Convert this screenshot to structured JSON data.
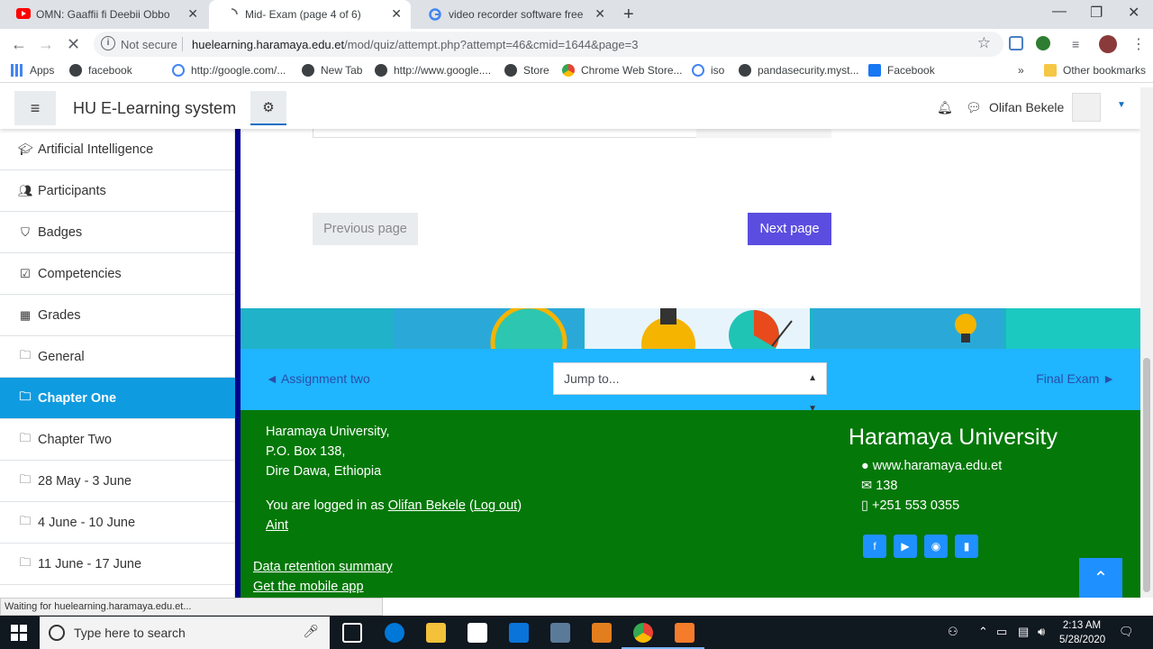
{
  "browser": {
    "tabs": [
      {
        "title": "OMN: Gaaffii fi Deebii Obbo Hay",
        "icon": "youtube-icon",
        "active": false
      },
      {
        "title": "Mid- Exam (page 4 of 6)",
        "icon": "loading-icon",
        "active": true
      },
      {
        "title": "video recorder software free dow",
        "icon": "google-icon",
        "active": false
      }
    ],
    "security": "Not secure",
    "url_host": "huelearning.haramaya.edu.et",
    "url_path": "/mod/quiz/attempt.php?attempt=46&cmid=1644&page=3",
    "bookmarks": [
      {
        "label": "Apps",
        "icon": "apps-grid-icon"
      },
      {
        "label": "facebook",
        "icon": "globe-icon"
      },
      {
        "label": "http://google.com/...",
        "icon": "google-icon"
      },
      {
        "label": "New Tab",
        "icon": "globe-icon"
      },
      {
        "label": "http://www.google....",
        "icon": "globe-icon"
      },
      {
        "label": "Store",
        "icon": "globe-icon"
      },
      {
        "label": "Chrome Web Store...",
        "icon": "chrome-store-icon"
      },
      {
        "label": "iso",
        "icon": "google-icon"
      },
      {
        "label": "pandasecurity.myst...",
        "icon": "globe-icon"
      },
      {
        "label": "Facebook",
        "icon": "facebook-icon"
      }
    ],
    "more_bookmarks": "»",
    "other_bookmarks": "Other bookmarks",
    "status_text": "Waiting for huelearning.haramaya.edu.et..."
  },
  "site": {
    "name": "HU E-Learning system",
    "user_name": "Olifan Bekele"
  },
  "sidebar": {
    "items": [
      {
        "label": "Artificial Intelligence",
        "icon": "graduation-cap-icon",
        "active": false
      },
      {
        "label": "Participants",
        "icon": "users-icon",
        "active": false
      },
      {
        "label": "Badges",
        "icon": "shield-icon",
        "active": false
      },
      {
        "label": "Competencies",
        "icon": "checkbox-icon",
        "active": false
      },
      {
        "label": "Grades",
        "icon": "table-icon",
        "active": false
      },
      {
        "label": "General",
        "icon": "folder-icon",
        "active": false
      },
      {
        "label": "Chapter One",
        "icon": "folder-icon",
        "active": true
      },
      {
        "label": "Chapter Two",
        "icon": "folder-icon",
        "active": false
      },
      {
        "label": "28 May - 3 June",
        "icon": "folder-icon",
        "active": false
      },
      {
        "label": "4 June - 10 June",
        "icon": "folder-icon",
        "active": false
      },
      {
        "label": "11 June - 17 June",
        "icon": "folder-icon",
        "active": false
      }
    ]
  },
  "quiz": {
    "prev_label": "Previous page",
    "next_label": "Next page"
  },
  "activity_nav": {
    "prev_label": "◄ Assignment two",
    "jump_placeholder": "Jump to...",
    "next_label": "Final Exam ►"
  },
  "footer": {
    "address_lines": [
      "Haramaya University,",
      "P.O. Box 138,",
      "Dire Dawa, Ethiopia"
    ],
    "logged_in_prefix": "You are logged in as",
    "logged_in_user": "Olifan Bekele",
    "logout": "Log out",
    "aint": "Aint",
    "data_retention": "Data retention summary",
    "mobile_app": "Get the mobile app",
    "uni_title": "Haramaya University",
    "website": "www.haramaya.edu.et",
    "pobox": "138",
    "phone": "+251 553 0355"
  },
  "taskbar": {
    "search_placeholder": "Type here to search",
    "time": "2:13 AM",
    "date": "5/28/2020"
  },
  "colors": {
    "active_nav": "#0f9be0",
    "next_button": "#5b4de0",
    "footer_green": "#047808",
    "activity_nav_blue": "#1fb5ff",
    "drawer_accent": "#00008b"
  }
}
